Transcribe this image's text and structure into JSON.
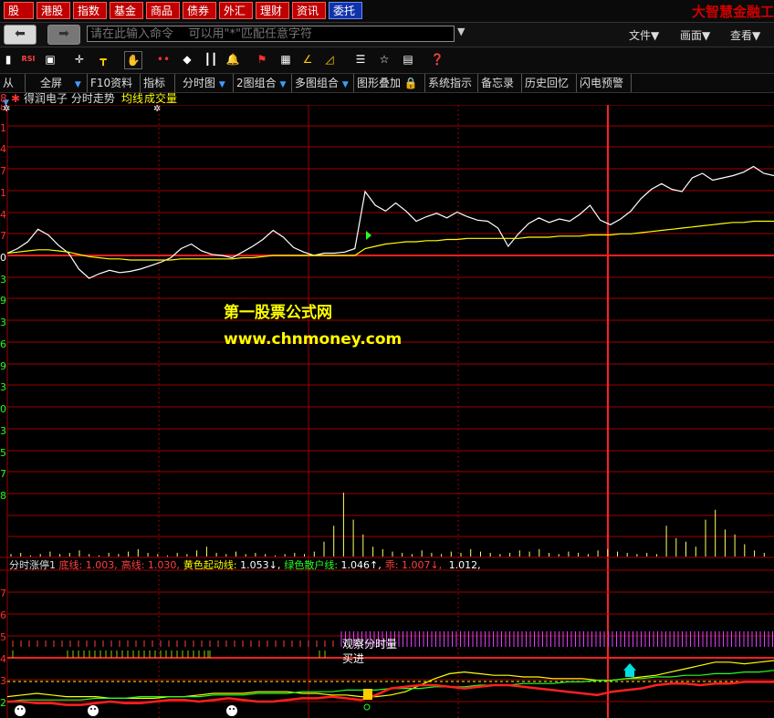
{
  "menu": {
    "tabs": [
      "股票",
      "港股",
      "指数",
      "基金",
      "商品",
      "债券",
      "外汇",
      "理财",
      "资讯",
      "委托"
    ],
    "active_tab": "委托",
    "brand": "大智慧金融工"
  },
  "command": {
    "placeholder": "请在此输入命令    可以用\"*\"匹配任意字符",
    "menus": [
      "文件▼",
      "画面▼",
      "查看▼"
    ]
  },
  "toolbar": {
    "icons": [
      "candle-icon",
      "rsi-icon",
      "chart-icon",
      "move-icon",
      "draw-tool-icon",
      "hand-icon",
      "dots-icon",
      "diamond-icon",
      "candles-icon",
      "bell-icon",
      "flag-icon",
      "image-icon",
      "angle-icon",
      "ruler-icon",
      "list-icon",
      "star-board-icon",
      "grid-icon",
      "help-icon"
    ],
    "rsi_label": "RSI"
  },
  "tabs": [
    "从",
    "全屏",
    "F10资料",
    "指标",
    "分时图",
    "2图组合",
    "多图组合",
    "图形叠加",
    "系统指示",
    "备忘录",
    "历史回忆",
    "闪电预警"
  ],
  "chart_title": {
    "stock": "得润电子 分时走势",
    "avg": "均线",
    "vol": "成交量"
  },
  "y_labels_upper": [
    "8",
    "1",
    "4",
    "7",
    "1",
    "4",
    "7",
    "0",
    "3",
    "9",
    "3",
    "6",
    "9",
    "3",
    "0",
    "3",
    "5",
    "7",
    "8"
  ],
  "y_labels_lower": [
    "7",
    "6",
    "5",
    "4",
    "3",
    "2",
    "1",
    "0"
  ],
  "watermark": {
    "line1": "第一股票公式网",
    "line2": "www.chnmoney.com"
  },
  "indicator": {
    "name": "分时涨停1",
    "items": [
      {
        "label": "底线:",
        "value": "1.003,",
        "color": "#ff4040"
      },
      {
        "label": "高线:",
        "value": "1.030,",
        "color": "#ff4040"
      },
      {
        "label": "黄色起动线:",
        "value": "1.053↓,",
        "color": "#ffff00"
      },
      {
        "label": "绿色散户线:",
        "value": "1.046↑,",
        "color": "#22ff22"
      },
      {
        "label": "乖:",
        "value": "1.007↓,",
        "color": "#ff4040"
      },
      {
        "label": "",
        "value": "1.012,",
        "color": "#dddddd"
      }
    ],
    "annotation1": "观察分时量",
    "annotation2": "买进"
  },
  "chart_data": {
    "type": "line",
    "series": [
      {
        "name": "分时走势",
        "color": "#ffffff",
        "values": [
          0.2,
          0.6,
          1.2,
          2.3,
          1.8,
          0.9,
          0.2,
          -1.2,
          -2.0,
          -1.6,
          -1.3,
          -1.5,
          -1.4,
          -1.2,
          -0.9,
          -0.6,
          -0.2,
          0.6,
          1.0,
          0.4,
          0.1,
          0.0,
          -0.2,
          0.3,
          0.8,
          1.4,
          2.2,
          1.6,
          0.7,
          0.3,
          0.0,
          0.2,
          0.2,
          0.3,
          0.6,
          5.6,
          4.4,
          3.9,
          4.6,
          3.9,
          3.0,
          3.4,
          3.7,
          3.3,
          3.8,
          3.4,
          3.1,
          3.0,
          2.4,
          0.8,
          1.9,
          2.8,
          3.3,
          2.9,
          3.2,
          3.0,
          3.6,
          4.4,
          3.1,
          2.7,
          3.2,
          3.9,
          5.0,
          5.8,
          6.3,
          5.8,
          5.6,
          6.8,
          7.2,
          6.6,
          6.8,
          7.0,
          7.3,
          7.8,
          7.2,
          7.0
        ]
      },
      {
        "name": "均线",
        "color": "#ffff00",
        "values": [
          0.2,
          0.3,
          0.4,
          0.5,
          0.5,
          0.4,
          0.3,
          0.1,
          -0.1,
          -0.2,
          -0.3,
          -0.3,
          -0.4,
          -0.4,
          -0.4,
          -0.4,
          -0.4,
          -0.3,
          -0.3,
          -0.3,
          -0.3,
          -0.3,
          -0.3,
          -0.2,
          -0.2,
          -0.1,
          0.0,
          0.0,
          0.0,
          0.0,
          0.0,
          0.0,
          0.0,
          0.0,
          0.0,
          0.6,
          0.8,
          1.0,
          1.1,
          1.2,
          1.2,
          1.3,
          1.3,
          1.4,
          1.4,
          1.5,
          1.5,
          1.5,
          1.5,
          1.5,
          1.5,
          1.6,
          1.6,
          1.6,
          1.7,
          1.7,
          1.7,
          1.8,
          1.8,
          1.8,
          1.9,
          1.9,
          2.0,
          2.1,
          2.2,
          2.3,
          2.4,
          2.5,
          2.6,
          2.7,
          2.8,
          2.9,
          2.9,
          3.0,
          3.0,
          3.0
        ]
      }
    ],
    "volume": [
      2,
      3,
      1,
      2,
      4,
      2,
      3,
      5,
      2,
      1,
      3,
      2,
      4,
      6,
      3,
      2,
      1,
      3,
      2,
      5,
      8,
      3,
      2,
      4,
      2,
      3,
      2,
      1,
      2,
      3,
      2,
      4,
      12,
      25,
      52,
      30,
      18,
      8,
      6,
      4,
      3,
      2,
      5,
      3,
      2,
      4,
      3,
      6,
      4,
      3,
      2,
      3,
      5,
      4,
      6,
      3,
      2,
      4,
      3,
      2,
      5,
      6,
      4,
      3,
      2,
      3,
      2,
      25,
      15,
      12,
      8,
      30,
      38,
      22,
      18,
      10,
      5,
      3
    ],
    "lower_series": [
      {
        "name": "黄色起动线",
        "color": "#ffff00",
        "values": [
          0.3,
          0.4,
          0.5,
          0.4,
          0.3,
          0.3,
          0.3,
          0.2,
          0.2,
          0.2,
          0.2,
          0.3,
          0.3,
          0.4,
          0.5,
          0.5,
          0.5,
          0.6,
          0.6,
          0.6,
          0.5,
          0.5,
          0.4,
          0.4,
          0.3,
          0.3,
          0.4,
          0.6,
          1.0,
          1.4,
          1.7,
          1.8,
          1.7,
          1.6,
          1.6,
          1.5,
          1.5,
          1.4,
          1.4,
          1.4,
          1.3,
          1.3,
          1.4,
          1.5,
          1.6,
          1.8,
          2.0,
          2.2,
          2.4,
          2.4,
          2.3,
          2.4,
          2.5
        ]
      },
      {
        "name": "绿色散户线",
        "color": "#22ff22",
        "values": [
          0.0,
          0.1,
          0.1,
          0.1,
          0.1,
          0.1,
          0.2,
          0.2,
          0.2,
          0.3,
          0.3,
          0.3,
          0.3,
          0.3,
          0.4,
          0.4,
          0.4,
          0.5,
          0.5,
          0.5,
          0.6,
          0.6,
          0.6,
          0.7,
          0.7,
          0.7,
          0.8,
          0.8,
          0.8,
          0.9,
          0.9,
          0.9,
          1.0,
          1.0,
          1.0,
          1.1,
          1.1,
          1.1,
          1.2,
          1.2,
          1.3,
          1.3,
          1.4,
          1.4,
          1.5,
          1.5,
          1.6,
          1.6,
          1.7,
          1.7,
          1.8,
          1.8,
          1.9
        ]
      },
      {
        "name": "底线",
        "color": "#ff2020",
        "values": [
          0.0,
          0.0,
          -0.1,
          -0.1,
          -0.2,
          -0.2,
          -0.1,
          0.0,
          -0.1,
          -0.1,
          0.0,
          0.1,
          0.1,
          0.0,
          0.1,
          0.2,
          0.1,
          0.0,
          0.0,
          0.1,
          0.2,
          0.2,
          0.3,
          0.2,
          0.1,
          0.4,
          0.8,
          0.9,
          1.0,
          1.0,
          0.9,
          0.8,
          0.9,
          1.0,
          1.0,
          0.9,
          0.8,
          0.7,
          0.6,
          0.5,
          0.4,
          0.6,
          0.7,
          0.8,
          1.0,
          1.1,
          1.1,
          1.0,
          1.1,
          1.1,
          1.2,
          1.2,
          1.2
        ]
      }
    ],
    "ylim_upper": [
      -4,
      10
    ],
    "ylim_lower": [
      0,
      7
    ]
  }
}
